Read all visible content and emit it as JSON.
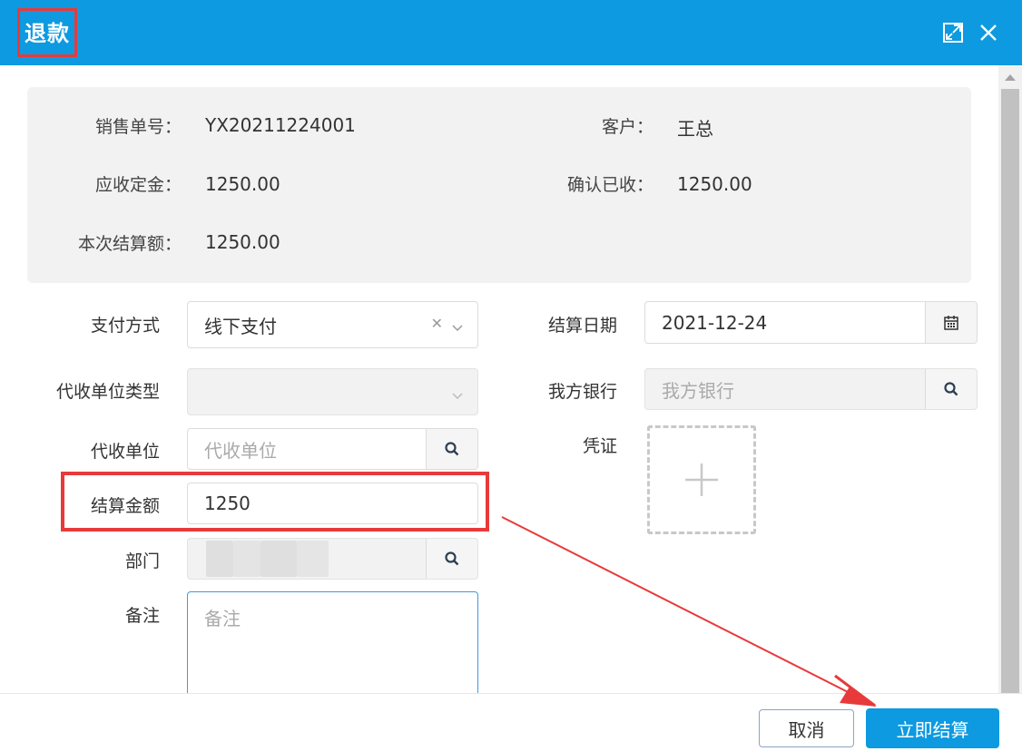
{
  "dialog": {
    "title": "退款",
    "maximize_icon": "maximize-icon",
    "close_icon": "close-icon"
  },
  "info": {
    "sales_no_label": "销售单号：",
    "sales_no_value": "YX20211224001",
    "customer_label": "客户：",
    "customer_value": "王总",
    "deposit_label": "应收定金：",
    "deposit_value": "1250.00",
    "received_label": "确认已收：",
    "received_value": "1250.00",
    "settle_label": "本次结算额：",
    "settle_value": "1250.00"
  },
  "form": {
    "payment_method_label": "支付方式",
    "payment_method_value": "线下支付",
    "collector_type_label": "代收单位类型",
    "collector_type_value": "",
    "collector_label": "代收单位",
    "collector_placeholder": "代收单位",
    "amount_label": "结算金额",
    "amount_value": "1250",
    "department_label": "部门",
    "remark_label": "备注",
    "remark_placeholder": "备注",
    "settle_date_label": "结算日期",
    "settle_date_value": "2021-12-24",
    "our_bank_label": "我方银行",
    "our_bank_placeholder": "我方银行",
    "voucher_label": "凭证"
  },
  "footer": {
    "cancel_label": "取消",
    "submit_label": "立即结算"
  },
  "colors": {
    "primary": "#0d9ae0",
    "annotation": "#e83a3a"
  }
}
